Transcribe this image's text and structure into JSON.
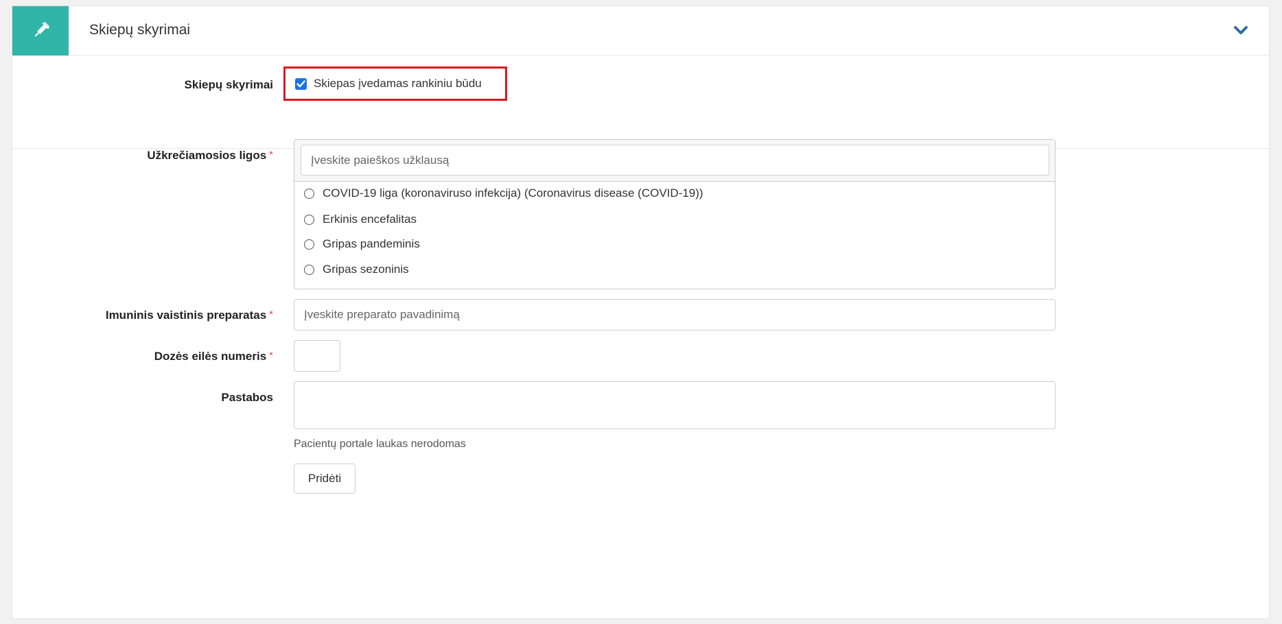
{
  "header": {
    "title": "Skiepų skyrimai",
    "icon": "syringe-icon",
    "accent_color": "#30b5a8",
    "toggle_icon": "chevron-down-icon"
  },
  "manual_entry": {
    "label": "Skiepų skyrimai",
    "checkbox_label": "Skiepas įvedamas rankiniu būdu",
    "checked": true,
    "highlight_color": "#e0141f"
  },
  "diseases": {
    "label": "Užkrečiamosios ligos",
    "required_mark": "*",
    "search_placeholder": "Įveskite paieškos užklausą",
    "options": [
      "COVID-19 liga (koronaviruso infekcija) (Coronavirus disease (COVID-19))",
      "Erkinis encefalitas",
      "Gripas pandeminis",
      "Gripas sezoninis"
    ]
  },
  "preparation": {
    "label": "Imuninis vaistinis preparatas",
    "required_mark": "*",
    "placeholder": "Įveskite preparato pavadinimą"
  },
  "dose": {
    "label": "Dozės eilės numeris",
    "required_mark": "*",
    "value": ""
  },
  "notes": {
    "label": "Pastabos",
    "value": "",
    "hint": "Pacientų portale laukas nerodomas"
  },
  "submit_label": "Pridėti"
}
